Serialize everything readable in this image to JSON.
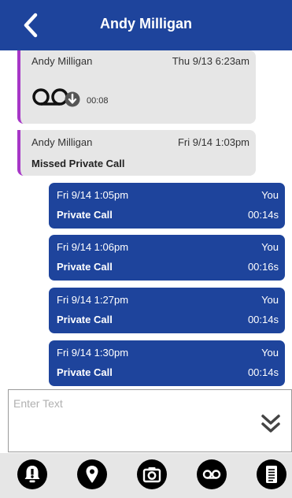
{
  "header": {
    "title": "Andy Milligan",
    "back_icon": "chevron-left-icon"
  },
  "thread": {
    "incoming": [
      {
        "sender": "Andy Milligan",
        "time": "Thu 9/13 6:23am",
        "kind": "voicemail",
        "duration": "00:08"
      },
      {
        "sender": "Andy Milligan",
        "time": "Fri 9/14 1:03pm",
        "kind": "missed",
        "label": "Missed Private Call"
      }
    ],
    "outgoing": [
      {
        "time": "Fri 9/14 1:05pm",
        "who": "You",
        "type": "Private Call",
        "duration": "00:14s"
      },
      {
        "time": "Fri 9/14 1:06pm",
        "who": "You",
        "type": "Private Call",
        "duration": "00:16s"
      },
      {
        "time": "Fri 9/14 1:27pm",
        "who": "You",
        "type": "Private Call",
        "duration": "00:14s"
      },
      {
        "time": "Fri 9/14 1:30pm",
        "who": "You",
        "type": "Private Call",
        "duration": "00:14s"
      }
    ]
  },
  "composer": {
    "placeholder": "Enter Text",
    "value": "",
    "collapse_icon": "double-chevron-down-icon"
  },
  "toolbar": {
    "items": [
      {
        "name": "alert-icon"
      },
      {
        "name": "location-pin-icon"
      },
      {
        "name": "camera-icon"
      },
      {
        "name": "voicemail-icon"
      },
      {
        "name": "notes-icon"
      }
    ]
  },
  "colors": {
    "header": "#1e449c",
    "outgoing": "#1e449c",
    "incoming": "#e6e6e6",
    "accent": "#a737c7",
    "toolbar": "#e6e6e6"
  }
}
